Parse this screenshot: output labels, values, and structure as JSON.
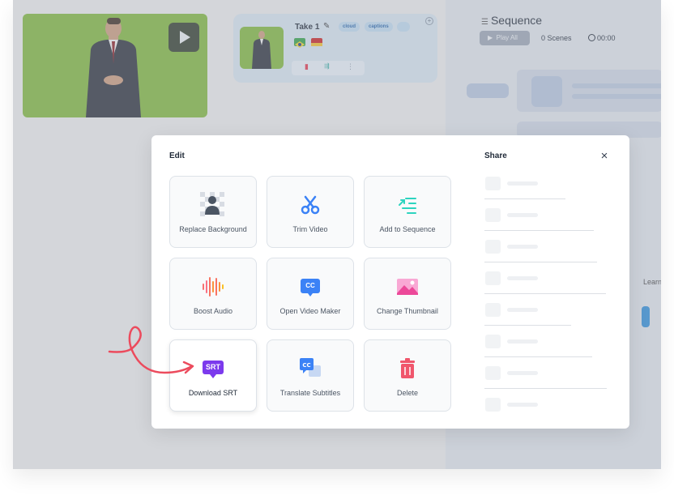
{
  "take": {
    "title": "Take 1",
    "tags": [
      "cloud",
      "captions"
    ]
  },
  "sequence": {
    "title": "Sequence",
    "play_all": "Play All",
    "scenes": "0 Scenes",
    "duration": "00:00",
    "learn_more": "Learn more"
  },
  "modal": {
    "edit_title": "Edit",
    "share_title": "Share",
    "close": "×",
    "actions": [
      {
        "label": "Replace Background",
        "icon": "replace-background-icon"
      },
      {
        "label": "Trim Video",
        "icon": "scissors-icon"
      },
      {
        "label": "Add to Sequence",
        "icon": "add-to-sequence-icon"
      },
      {
        "label": "Boost Audio",
        "icon": "audio-wave-icon"
      },
      {
        "label": "Open Video Maker",
        "icon": "cc-icon"
      },
      {
        "label": "Change Thumbnail",
        "icon": "image-icon"
      },
      {
        "label": "Download SRT",
        "icon": "srt-icon"
      },
      {
        "label": "Translate Subtitles",
        "icon": "translate-icon"
      },
      {
        "label": "Delete",
        "icon": "trash-icon"
      }
    ],
    "srt_badge": "SRT",
    "cc_badge": "CC"
  },
  "colors": {
    "accent_purple": "#7c3aed",
    "accent_blue": "#3b82f6",
    "accent_teal": "#2dd4bf",
    "accent_red": "#f0566c",
    "annotation": "#ec4b5d"
  }
}
